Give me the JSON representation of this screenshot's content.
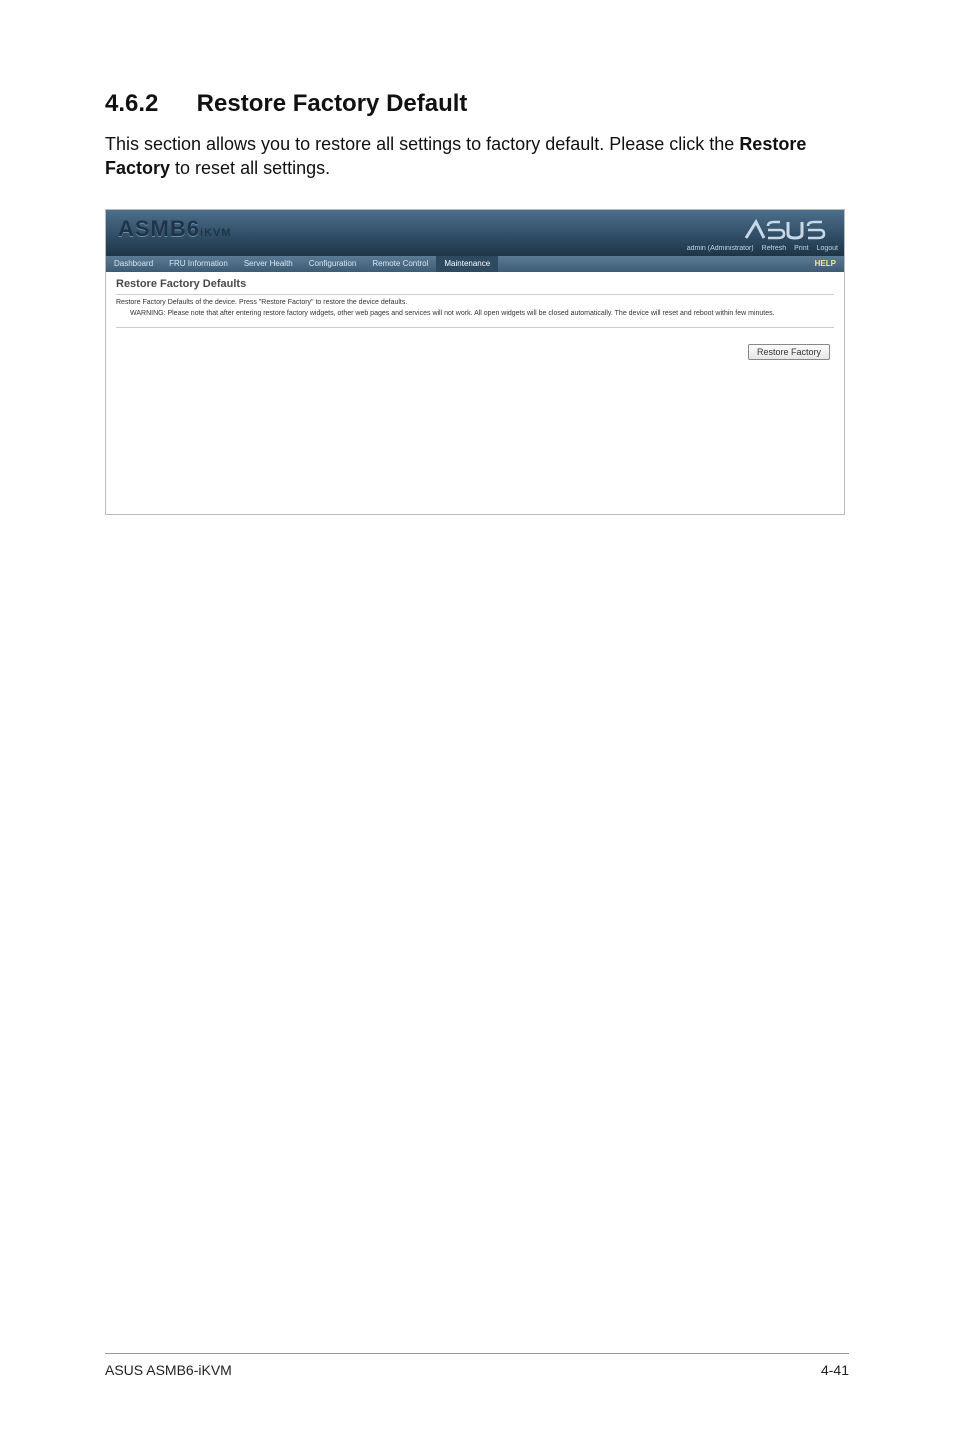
{
  "heading": {
    "number": "4.6.2",
    "title": "Restore Factory Default"
  },
  "body": {
    "line1": "This section allows you to restore all settings to factory default. Please click the ",
    "strong": "Restore Factory",
    "line2": " to reset all settings."
  },
  "screenshot": {
    "brand_main": "ASMB6",
    "brand_sub": "iKVM",
    "topbar": {
      "user_label": "admin (Administrator)",
      "refresh": "Refresh",
      "print": "Print",
      "logout": "Logout"
    },
    "menu": {
      "items": [
        "Dashboard",
        "FRU Information",
        "Server Health",
        "Configuration",
        "Remote Control",
        "Maintenance"
      ],
      "active_index": 5,
      "help": "HELP"
    },
    "panel": {
      "title": "Restore Factory Defaults",
      "desc": "Restore Factory Defaults of the device. Press \"Restore Factory\" to restore the device defaults.",
      "warning": "WARNING: Please note that after entering restore factory widgets, other web pages and services will not work. All open widgets will be closed automatically. The device will reset and reboot within few minutes.",
      "button": "Restore Factory"
    }
  },
  "footer": {
    "left": "ASUS ASMB6-iKVM",
    "right": "4-41"
  }
}
